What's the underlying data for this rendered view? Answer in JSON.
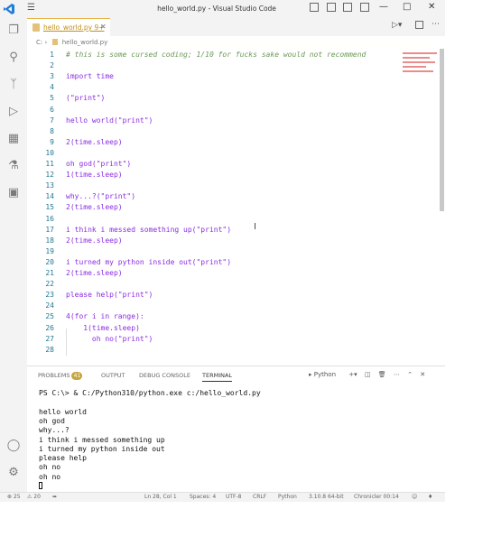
{
  "window": {
    "title": "hello_world.py - Visual Studio Code",
    "controls": [
      "—",
      "□",
      "✕"
    ]
  },
  "tab": {
    "label": "hello_world.py 9+",
    "close": "✕"
  },
  "breadcrumb": {
    "folder": "C: ›",
    "file": "hello_world.py"
  },
  "editor": {
    "lines": [
      {
        "n": "1",
        "text": "# this is some cursed coding; 1/10 for fucks sake would not recommend",
        "kind": "comment"
      },
      {
        "n": "2",
        "text": ""
      },
      {
        "n": "3",
        "text": "import time"
      },
      {
        "n": "4",
        "text": ""
      },
      {
        "n": "5",
        "text": "(\"print\")"
      },
      {
        "n": "6",
        "text": ""
      },
      {
        "n": "7",
        "text": "hello world(\"print\")"
      },
      {
        "n": "8",
        "text": ""
      },
      {
        "n": "9",
        "text": "2(time.sleep)"
      },
      {
        "n": "10",
        "text": ""
      },
      {
        "n": "11",
        "text": "oh god(\"print\")"
      },
      {
        "n": "12",
        "text": "1(time.sleep)"
      },
      {
        "n": "13",
        "text": ""
      },
      {
        "n": "14",
        "text": "why...?(\"print\")"
      },
      {
        "n": "15",
        "text": "2(time.sleep)"
      },
      {
        "n": "16",
        "text": ""
      },
      {
        "n": "17",
        "text": "i think i messed something up(\"print\")"
      },
      {
        "n": "18",
        "text": "2(time.sleep)"
      },
      {
        "n": "19",
        "text": ""
      },
      {
        "n": "20",
        "text": "i turned my python inside out(\"print\")"
      },
      {
        "n": "21",
        "text": "2(time.sleep)"
      },
      {
        "n": "22",
        "text": ""
      },
      {
        "n": "23",
        "text": "please help(\"print\")"
      },
      {
        "n": "24",
        "text": ""
      },
      {
        "n": "25",
        "text": "4(for i in range):"
      },
      {
        "n": "26",
        "text": "    1(time.sleep)"
      },
      {
        "n": "27",
        "text": "      oh no(\"print\")"
      },
      {
        "n": "28",
        "text": ""
      }
    ]
  },
  "panel": {
    "tabs": [
      "PROBLEMS",
      "OUTPUT",
      "DEBUG CONSOLE",
      "TERMINAL"
    ],
    "problems_count": "41",
    "terminal_kind": "Python",
    "terminal_lines": [
      "PS C:\\> & C:/Python310/python.exe c:/hello_world.py",
      "",
      "hello world",
      "oh god",
      "why...?",
      "i think i messed something up",
      "i turned my python inside out",
      "please help",
      "oh no",
      "oh no"
    ]
  },
  "status": {
    "errors": "⊗ 25",
    "warnings": "⚠ 20",
    "position": "Ln 28, Col 1",
    "spaces": "Spaces: 4",
    "encoding": "UTF-8",
    "eol": "CRLF",
    "language": "Python",
    "interpreter": "3.10.8 64-bit",
    "extra": "Chronicler 00:14"
  },
  "colors": {
    "accent": "#e8b34a",
    "keyword": "#8a2be2",
    "linenum": "#237893"
  }
}
